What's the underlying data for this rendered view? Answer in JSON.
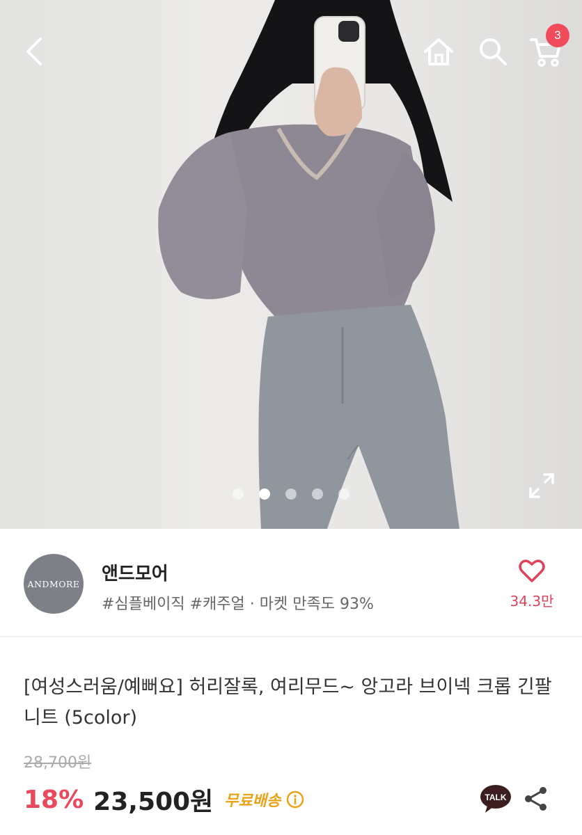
{
  "header": {
    "cart_count": "3"
  },
  "gallery": {
    "dot_count": 5,
    "active_index": 1
  },
  "seller": {
    "logo_text": "ANDMORE",
    "name": "앤드모어",
    "tags": "#심플베이직 #캐주얼 · 마켓 만족도 93%",
    "likes": "34.3만"
  },
  "product": {
    "title": "[여성스러움/예뻐요] 허리잘록, 여리무드~ 앙고라 브이넥 크롭 긴팔니트 (5color)",
    "original_price": "28,700원",
    "discount": "18%",
    "price": "23,500원",
    "free_shipping": "무료배송"
  },
  "colors": {
    "accent": "#e8495b",
    "badge": "#f04b5a",
    "shipping": "#e8a317",
    "kakao": "#3c1e1e"
  },
  "icons": {
    "back": "chevron-left-icon",
    "home": "home-icon",
    "search": "search-icon",
    "cart": "cart-icon",
    "expand": "expand-icon",
    "heart": "heart-icon",
    "info": "info-icon",
    "talk": "kakao-talk-icon",
    "share": "share-icon"
  }
}
